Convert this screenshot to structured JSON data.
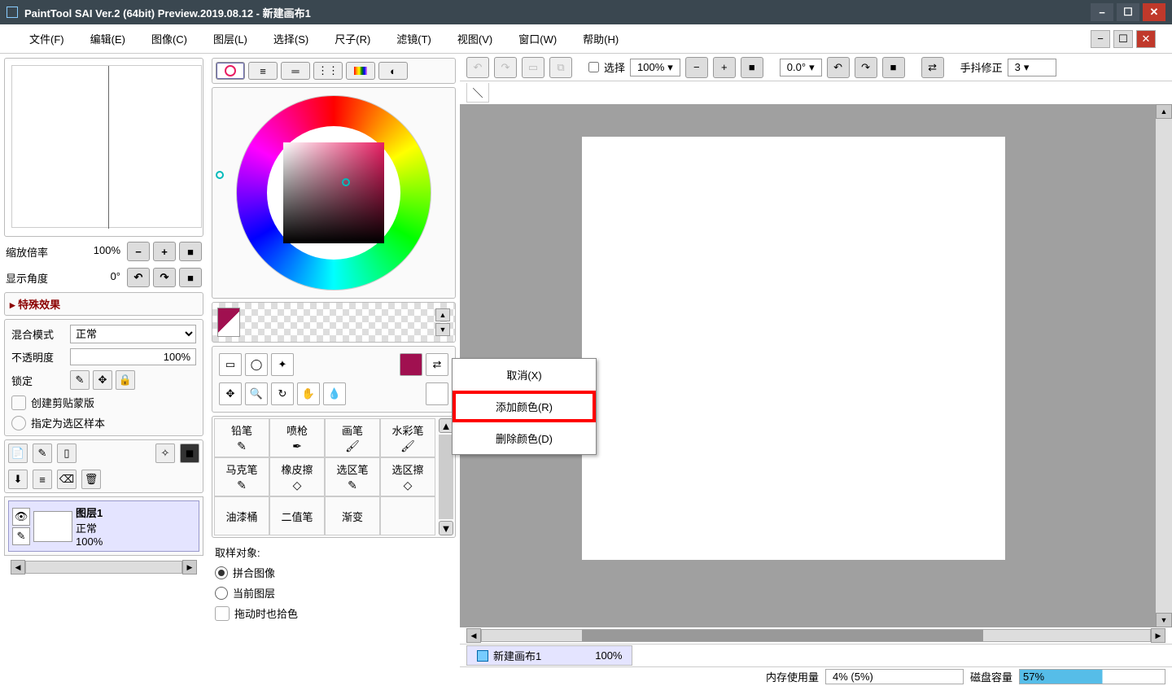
{
  "window": {
    "title": "PaintTool SAI Ver.2 (64bit) Preview.2019.08.12 - 新建画布1"
  },
  "menu": {
    "file": "文件(F)",
    "edit": "编辑(E)",
    "image": "图像(C)",
    "layer": "图层(L)",
    "select": "选择(S)",
    "ruler": "尺子(R)",
    "filter": "滤镜(T)",
    "view": "视图(V)",
    "window": "窗口(W)",
    "help": "帮助(H)"
  },
  "nav": {
    "zoom_label": "缩放倍率",
    "zoom_value": "100%",
    "angle_label": "显示角度",
    "angle_value": "0°",
    "special_fx": "特殊效果"
  },
  "layer_props": {
    "blend_label": "混合模式",
    "blend_value": "正常",
    "opacity_label": "不透明度",
    "opacity_value": "100%",
    "lock_label": "锁定",
    "clipmask": "创建剪贴蒙版",
    "sel_sample": "指定为选区样本"
  },
  "layer": {
    "name": "图层1",
    "mode": "正常",
    "opacity": "100%"
  },
  "context_menu": {
    "cancel": "取消(X)",
    "add_color": "添加颜色(R)",
    "del_color": "删除颜色(D)"
  },
  "brushes": {
    "b0": "铅笔",
    "b1": "喷枪",
    "b2": "画笔",
    "b3": "水彩笔",
    "b4": "马克笔",
    "b5": "橡皮擦",
    "b6": "选区笔",
    "b7": "选区擦",
    "b8": "油漆桶",
    "b9": "二值笔",
    "b10": "渐变"
  },
  "sampling": {
    "heading": "取样对象:",
    "merged": "拼合图像",
    "current": "当前图层",
    "drag_pick": "拖动时也拾色"
  },
  "right_tb": {
    "select_label": "选择",
    "zoom": "100%",
    "angle": "0.0°",
    "stabilizer_label": "手抖修正",
    "stabilizer_value": "3"
  },
  "doc_tab": {
    "name": "新建画布1",
    "zoom": "100%"
  },
  "status": {
    "mem_label": "内存使用量",
    "mem_value": "4% (5%)",
    "disk_label": "磁盘容量",
    "disk_value": "57%"
  }
}
